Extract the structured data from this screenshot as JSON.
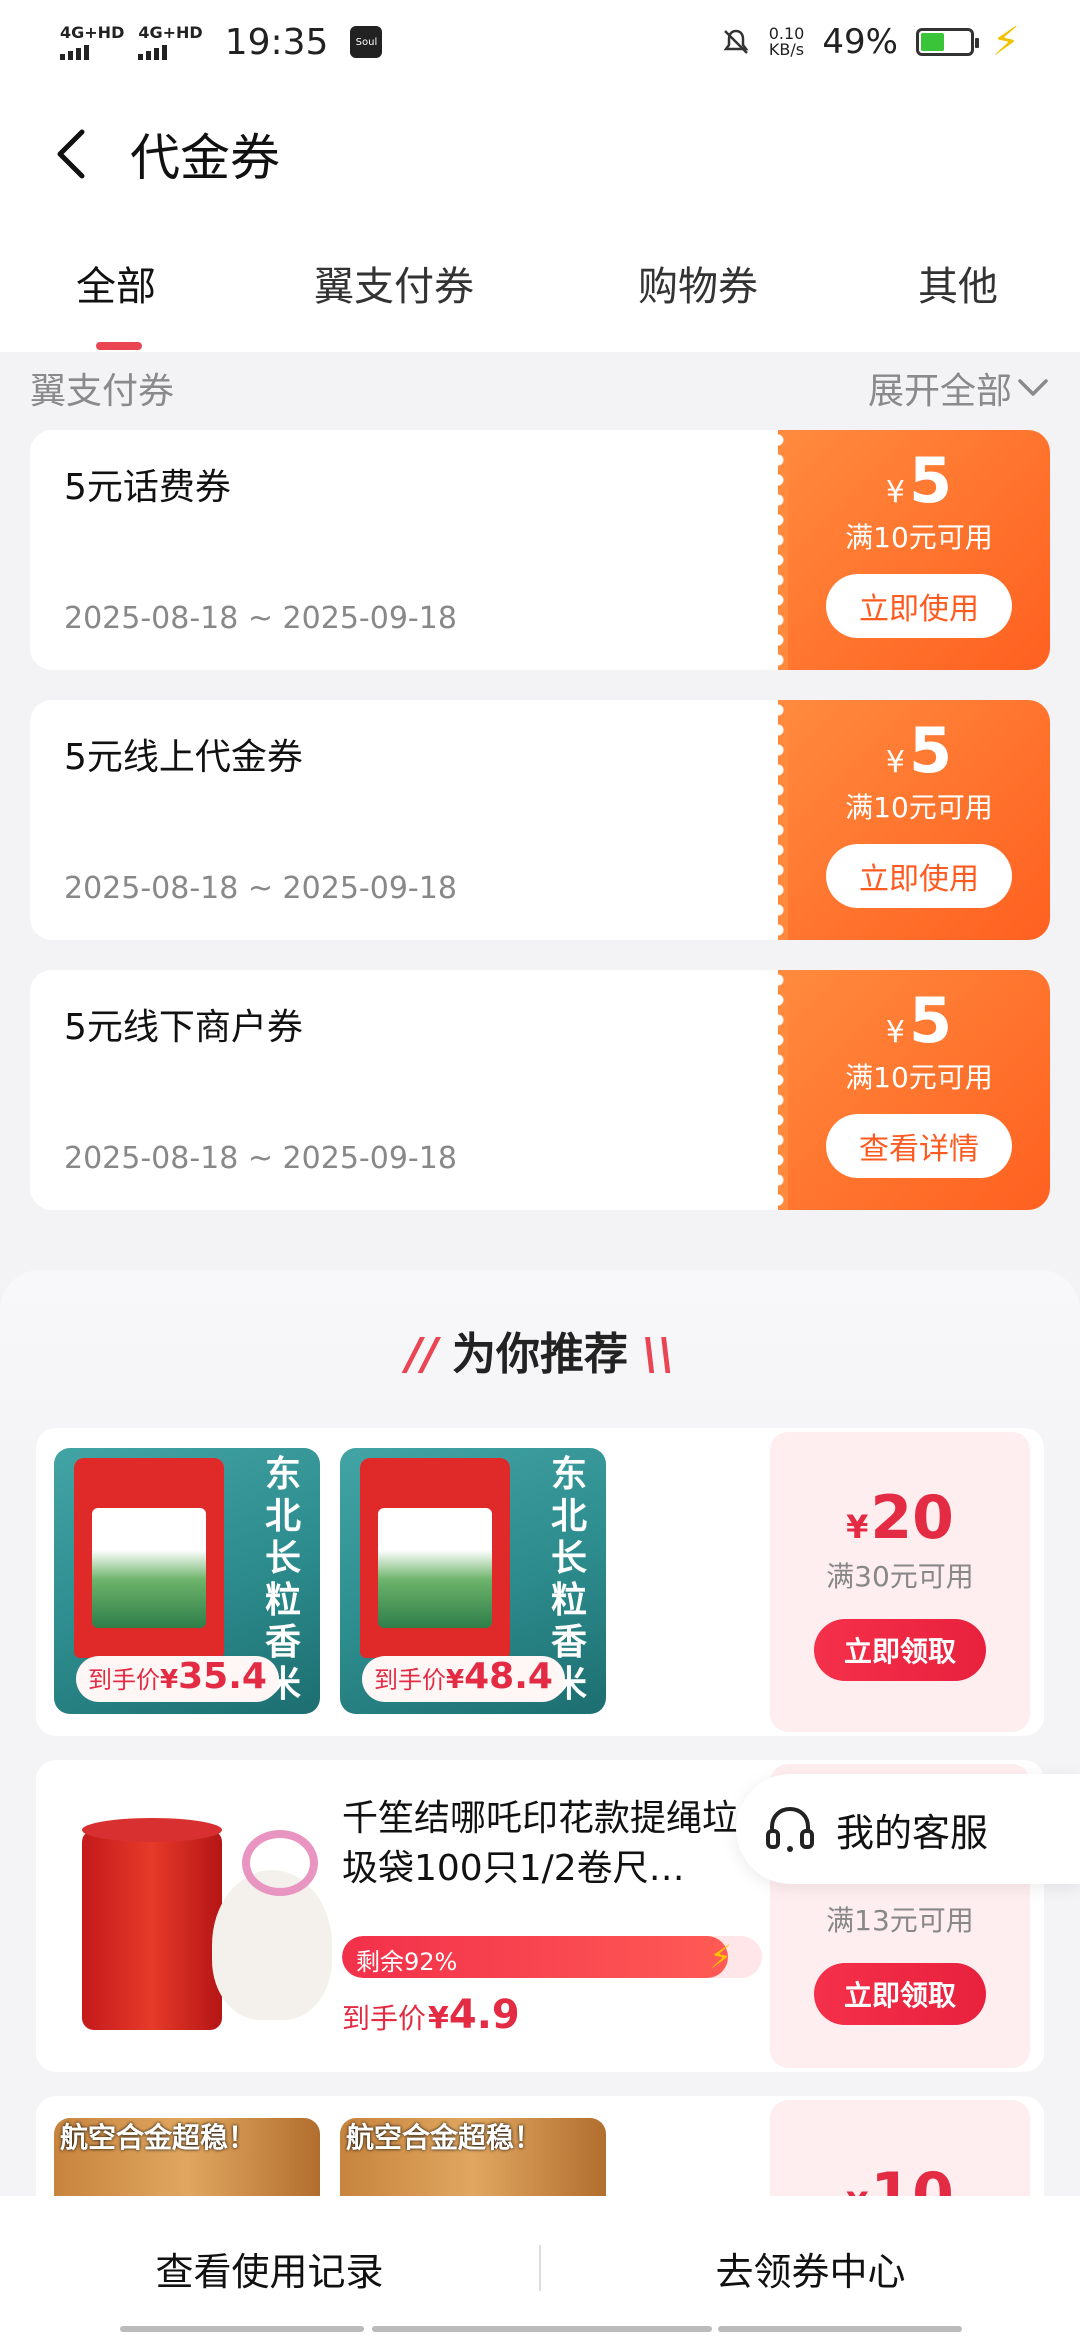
{
  "status_bar": {
    "sim1": "4G+HD",
    "sim2": "4G+HD",
    "time": "19:35",
    "app_icon": "Soul",
    "speed_value": "0.10",
    "speed_unit": "KB/s",
    "battery": "49%",
    "battery_level": 0.49
  },
  "header": {
    "title": "代金券"
  },
  "tabs": [
    {
      "label": "全部",
      "active": true
    },
    {
      "label": "翼支付券",
      "active": false
    },
    {
      "label": "购物券",
      "active": false
    },
    {
      "label": "其他",
      "active": false
    }
  ],
  "section": {
    "title": "翼支付券",
    "expand_label": "展开全部"
  },
  "coupons": [
    {
      "name": "5元话费券",
      "date": "2025-08-18 ~ 2025-09-18",
      "currency": "¥",
      "amount": "5",
      "condition": "满10元可用",
      "button": "立即使用"
    },
    {
      "name": "5元线上代金券",
      "date": "2025-08-18 ~ 2025-09-18",
      "currency": "¥",
      "amount": "5",
      "condition": "满10元可用",
      "button": "立即使用"
    },
    {
      "name": "5元线下商户券",
      "date": "2025-08-18 ~ 2025-09-18",
      "currency": "¥",
      "amount": "5",
      "condition": "满10元可用",
      "button": "查看详情"
    }
  ],
  "recommend": {
    "title": "为你推荐",
    "cards": [
      {
        "products": [
          {
            "image_text": "东北长粒香米",
            "price_label": "到手价",
            "currency": "¥",
            "price": "35.4"
          },
          {
            "image_text": "东北长粒香米",
            "price_label": "到手价",
            "currency": "¥",
            "price": "48.4"
          }
        ],
        "coupon_currency": "¥",
        "coupon_amount": "20",
        "coupon_condition": "满30元可用",
        "button": "立即领取"
      },
      {
        "product_name": "千笙结哪吒印花款提绳垃圾袋100只1/2卷尺…",
        "remaining": "剩余92%",
        "remaining_fraction": 0.92,
        "price_label": "到手价",
        "currency": "¥",
        "price": "4.9",
        "coupon_condition": "满13元可用",
        "button": "立即领取"
      },
      {
        "products": [
          {
            "image_text": "航空合金超稳！"
          },
          {
            "image_text": "航空合金超稳！"
          }
        ],
        "coupon_currency": "¥",
        "coupon_amount": "10"
      }
    ]
  },
  "customer_service": {
    "label": "我的客服"
  },
  "bottom_bar": {
    "left": "查看使用记录",
    "right": "去领券中心"
  },
  "colors": {
    "accent": "#e94553",
    "coupon_orange": "#ff6a2a",
    "price_red": "#e32c44"
  }
}
